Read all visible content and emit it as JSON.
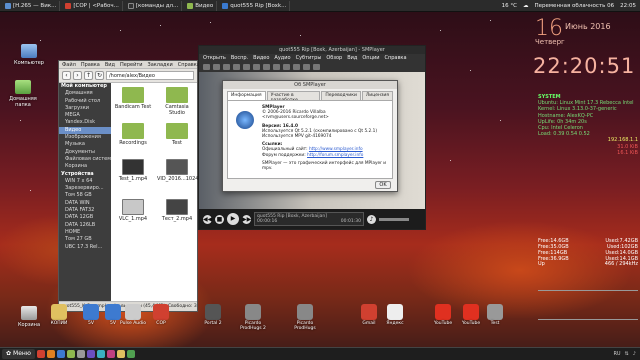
{
  "top_panel": {
    "tabs": [
      "[H.265 — Вик...",
      "[COP | <Рабоч...",
      "[команды дл...",
      "Видео",
      "quot555 Rip [Boxk..."
    ],
    "temp": "16 °C",
    "weather": "Переменная облачность 06",
    "time": "22:05"
  },
  "desktop_icons": [
    {
      "label": "Компьютер",
      "color": "#6fa0d8"
    },
    {
      "label": "Домашняя папка",
      "color": "#7ec860"
    },
    {
      "label": "Корзина",
      "color": "#c8c8c8"
    }
  ],
  "calendar": {
    "day": "16",
    "weekday": "Четверг",
    "month": "Июнь 2016"
  },
  "clock": "22:20:51",
  "conky": {
    "header": "SYSTEM",
    "lines": [
      "Ubuntu: Linux Mint 17.3 Rebecca Intel",
      "Kernel: Linux 3.13.0-37-generic",
      "Hostname: AlexKQ-PC",
      "UpLife: 0h 34m 20s",
      "Cpu: Intel Celeron",
      "Load: 0.39 0.54 0.52"
    ],
    "ip": "192.168.1.1",
    "speeds": [
      "31.0 KiB",
      "16.1 KiB"
    ]
  },
  "disks": [
    {
      "free": "Free:14.6GB",
      "used": "Used:7.42GB"
    },
    {
      "free": "Free:35.0GB",
      "used": "Used:102GB"
    },
    {
      "free": "Free:114GB",
      "used": "Used:14.0GB"
    },
    {
      "free": "Free:36.9GB",
      "used": "Used:14.1GB"
    }
  ],
  "graph": {
    "label_left": "Up",
    "label_right": "466 / 294kHz"
  },
  "file_manager": {
    "menu": [
      "Файл",
      "Правка",
      "Вид",
      "Перейти",
      "Закладки",
      "Справка"
    ],
    "path": "/home/alex/Видео",
    "sidebar": [
      {
        "label": "Мой компьютер",
        "header": true
      },
      {
        "label": "Домашняя"
      },
      {
        "label": "Рабочий стол"
      },
      {
        "label": "Загрузки"
      },
      {
        "label": "MEGA"
      },
      {
        "label": "Yandex.Disk"
      },
      {
        "label": "Видео",
        "selected": true
      },
      {
        "label": "Изображения"
      },
      {
        "label": "Музыка"
      },
      {
        "label": "Документы"
      },
      {
        "label": "Файловая система"
      },
      {
        "label": "Корзина"
      },
      {
        "label": "Устройства",
        "header": true
      },
      {
        "label": "WIN 7 x 64"
      },
      {
        "label": "Зарезервиро..."
      },
      {
        "label": "Том 58 GB"
      },
      {
        "label": "DATA WIN"
      },
      {
        "label": "DATA FAT32"
      },
      {
        "label": "DATA 12GB"
      },
      {
        "label": "DATA 126LB"
      },
      {
        "label": "HOME"
      },
      {
        "label": "Том 27 GB"
      },
      {
        "label": "UBC 17.3 Rel..."
      }
    ],
    "files": [
      {
        "name": "Bandicam Test",
        "kind": "folder"
      },
      {
        "name": "Camtasia Studio",
        "kind": "folder"
      },
      {
        "name": "Recordings",
        "kind": "folder"
      },
      {
        "name": "Test",
        "kind": "folder"
      },
      {
        "name": "Test_1.mp4",
        "kind": "video"
      },
      {
        "name": "VID_2016...102436.mp4",
        "kind": "video"
      },
      {
        "name": "VLC_1.mp4",
        "kind": "video"
      },
      {
        "name": "Тест_2.mp4",
        "kind": "video"
      }
    ],
    "status": "quot555_K_P_sample.mkv выделен (45,4 МБ), Свободно: 37,6 ГБ"
  },
  "smplayer": {
    "title": "quot555 Rip [Boxk, Azerbaijan] - SMPlayer",
    "menu": [
      "Открыть",
      "Воспр.",
      "Видео",
      "Аудио",
      "Субтитры",
      "Обзор",
      "Вид",
      "Опции",
      "Справка"
    ],
    "lcd_title": "quot555 Rip [Boxk, Azerbaijan]",
    "lcd_time": "00:00:16",
    "lcd_total": "00:01:30"
  },
  "about": {
    "title": "Об SMPlayer",
    "tabs": [
      "Информация",
      "Участие в разработке",
      "Переводчики",
      "Лицензия"
    ],
    "app": "SMPlayer",
    "copyright": "© 2006-2016 Ricardo Villalba",
    "email": "<rvm@users.sourceforge.net>",
    "version": "Версия: 16.4.0",
    "qt": "Используется Qt 5.2.1 (скомпилировано с Qt 5.2.1)",
    "mpv": "Используется MPV git-4169074",
    "links_header": "Ссылки:",
    "site_label": "Официальный сайт:",
    "site": "http://www.smplayer.info",
    "forum_label": "Форум поддержки:",
    "forum": "http://forum.smplayer.info",
    "footer": "SMPlayer — это графический интерфейс для MPlayer и mpv.",
    "ok": "OK"
  },
  "dock": [
    {
      "label": "КОПИИ",
      "color": "#e0c060"
    },
    {
      "label": "5V",
      "color": "#3d7ad0"
    },
    {
      "label": "5V",
      "color": "#3d7ad0"
    },
    {
      "label": "Pulse Audio",
      "color": "#ccc"
    },
    {
      "label": "COP",
      "color": "#d04030"
    },
    {
      "label": "Portal 2",
      "color": "#555"
    },
    {
      "label": "Picardo ProdHugs 2",
      "color": "#888"
    },
    {
      "label": "Picardo ProdHugs",
      "color": "#888"
    },
    {
      "label": "Gmail",
      "color": "#d04030"
    },
    {
      "label": "Яндекс",
      "color": "#eee"
    },
    {
      "label": "YouTube",
      "color": "#e03020"
    },
    {
      "label": "YouTube",
      "color": "#e03020"
    },
    {
      "label": "Test",
      "color": "#999"
    }
  ],
  "taskbar": {
    "menu_label": "Меню",
    "layout": "RU"
  }
}
